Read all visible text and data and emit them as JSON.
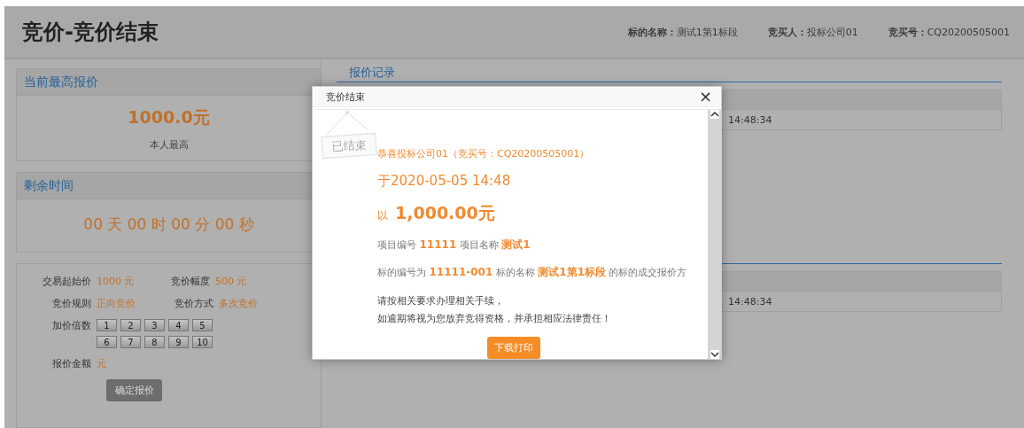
{
  "header": {
    "title": "竞价-竞价结束",
    "meta": [
      {
        "label": "标的名称：",
        "value": "测试1第1标段"
      },
      {
        "label": "竞买人：",
        "value": "投标公司01"
      },
      {
        "label": "竞买号：",
        "value": "CQ20200505001"
      }
    ]
  },
  "highest_bid": {
    "title": "当前最高报价",
    "amount": "1000.0元",
    "note": "本人最高"
  },
  "remaining": {
    "title": "剩余时间",
    "countdown": "00 天 00 时 00 分 00 秒"
  },
  "bid_form": {
    "rows": [
      [
        {
          "label": "交易起始价",
          "value": "1000 元"
        },
        {
          "label": "竞价幅度",
          "value": "500 元"
        }
      ],
      [
        {
          "label": "竞价规则",
          "value": "正向竞价"
        },
        {
          "label": "竞价方式",
          "value": "多次竞价"
        }
      ]
    ],
    "multiplier_label": "加价倍数",
    "multipliers": [
      "1",
      "2",
      "3",
      "4",
      "5",
      "6",
      "7",
      "8",
      "9",
      "10"
    ],
    "amount_label": "报价金额",
    "amount_unit": "元",
    "submit": "确定报价"
  },
  "records": {
    "title": "报价记录",
    "sections": [
      {
        "rows": [
          {
            "time": "14:48:34"
          }
        ]
      },
      {
        "rows": [
          {
            "time": "14:48:34"
          }
        ]
      }
    ]
  },
  "dialog": {
    "title": "竞价结束",
    "close": "×",
    "stamp": "已结束",
    "congrats": "恭喜投标公司01（竞买号：CQ20200505001）",
    "date": "于2020-05-05 14:48",
    "price_prefix": "以",
    "price": "1,000.00元",
    "project": "项目编号 **11111** 项目名称 **测试1**",
    "lot": "标的编号为 **11111-001** 标的名称 **测试1第1标段** 的标的成交报价方",
    "notice": [
      "请按相关要求办理相关手续，",
      "如逾期将视为您放弃竞得资格，并承担相应法律责任！"
    ],
    "download": "下载打印"
  }
}
